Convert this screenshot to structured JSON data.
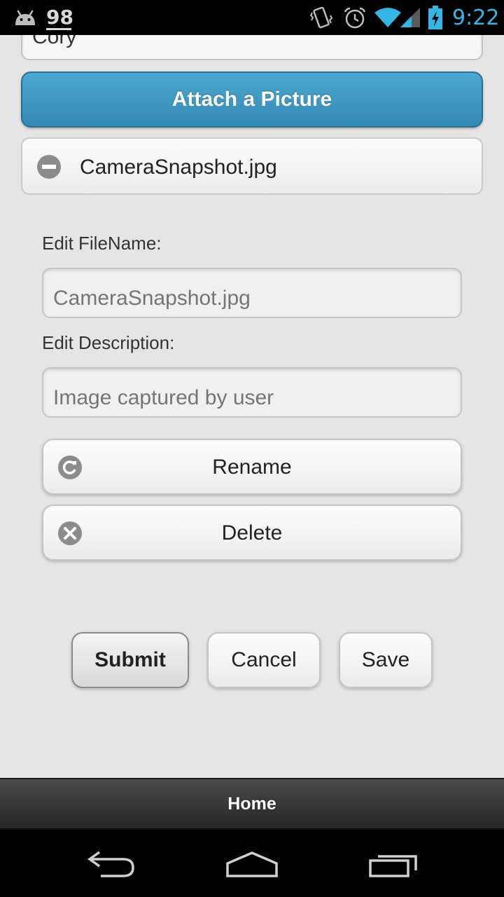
{
  "status_bar": {
    "notification_count": "98",
    "time": "9:22",
    "icons": [
      "android-icon",
      "vibrate-icon",
      "alarm-icon",
      "wifi-icon",
      "signal-icon",
      "battery-charging-icon"
    ]
  },
  "form": {
    "name_value": "Cory",
    "attach_button_label": "Attach a Picture",
    "attached_file": {
      "name": "CameraSnapshot.jpg",
      "icon": "minus-circle-icon"
    },
    "edit_filename_label": "Edit FileName:",
    "edit_filename_placeholder": "CameraSnapshot.jpg",
    "edit_description_label": "Edit Description:",
    "edit_description_placeholder": "Image captured by user",
    "rename_button_label": "Rename",
    "rename_icon": "refresh-icon",
    "delete_button_label": "Delete",
    "delete_icon": "close-circle-icon"
  },
  "actions": {
    "submit_label": "Submit",
    "cancel_label": "Cancel",
    "save_label": "Save"
  },
  "footer": {
    "title": "Home"
  },
  "colors": {
    "accent_blue": "#3a97c2",
    "clock_blue": "#33b5e5",
    "page_background": "#e5e5e5"
  }
}
